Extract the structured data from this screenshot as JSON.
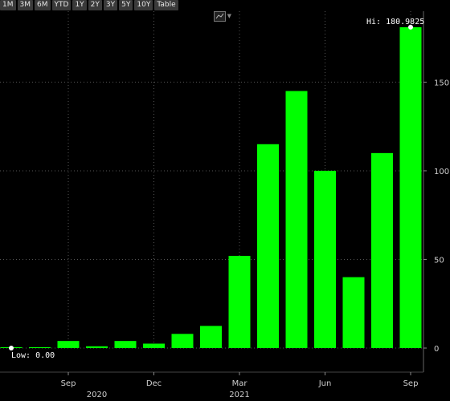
{
  "toolbar": {
    "ranges": [
      "1M",
      "3M",
      "6M",
      "YTD",
      "1Y",
      "2Y",
      "3Y",
      "5Y",
      "10Y",
      "Table"
    ]
  },
  "chart_type_icon": "line-chart-icon",
  "chart_data": {
    "type": "bar",
    "color": "#00ff00",
    "background": "#000000",
    "x": [
      "2020-07",
      "2020-08",
      "2020-09",
      "2020-10",
      "2020-11",
      "2020-12",
      "2021-01",
      "2021-02",
      "2021-03",
      "2021-04",
      "2021-05",
      "2021-06",
      "2021-07",
      "2021-08",
      "2021-09"
    ],
    "values": [
      0,
      0.5,
      4,
      1,
      4,
      2.5,
      8,
      12.5,
      52,
      115,
      145,
      100,
      40,
      110,
      181
    ],
    "ylim": [
      0,
      190
    ],
    "yticks": [
      0,
      50,
      100,
      150
    ],
    "xticks": [
      {
        "label": "Sep",
        "at": "2020-09"
      },
      {
        "label": "Dec",
        "at": "2020-12"
      },
      {
        "label": "Mar",
        "at": "2021-03"
      },
      {
        "label": "Jun",
        "at": "2021-06"
      },
      {
        "label": "Sep",
        "at": "2021-09"
      }
    ],
    "year_labels": [
      {
        "label": "2020",
        "at": "2020-10"
      },
      {
        "label": "2021",
        "at": "2021-03"
      }
    ],
    "high": {
      "text": "Hi: 180.9825",
      "value": 180.9825,
      "at": "2021-09"
    },
    "low": {
      "text": "Low: 0.00",
      "value": 0,
      "at": "2020-07"
    },
    "grid": "dotted"
  }
}
